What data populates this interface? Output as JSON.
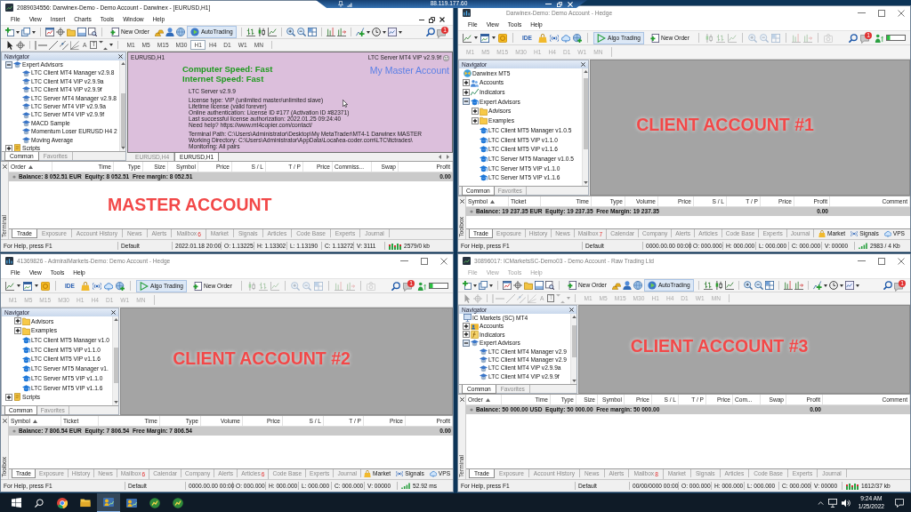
{
  "remote_bar": {
    "address": "88.119.177.60"
  },
  "windows": [
    {
      "kind": "mt4",
      "active": true,
      "caption_buttons": false,
      "title": "2089034556: Darwinex-Demo - Demo Account - Darwinex - [EURUSD,H1]",
      "menu": {
        "disabled": false,
        "items": [
          "File",
          "View",
          "Insert",
          "Charts",
          "Tools",
          "Window",
          "Help"
        ]
      },
      "toolbar": {
        "buttons": [
          {
            "label": "New Order",
            "on": false
          },
          {
            "label": "AutoTrading",
            "on": true
          }
        ],
        "alerts": "1"
      },
      "chart_tools": {
        "disabled": false,
        "labels": [
          "A",
          "T"
        ],
        "timeframes": [
          {
            "label": "M1",
            "selected": false
          },
          {
            "label": "M5",
            "selected": false
          },
          {
            "label": "M15",
            "selected": false
          },
          {
            "label": "M30",
            "selected": false
          },
          {
            "label": "H1",
            "selected": true
          },
          {
            "label": "H4",
            "selected": false
          },
          {
            "label": "D1",
            "selected": false
          },
          {
            "label": "W1",
            "selected": false
          },
          {
            "label": "MN",
            "selected": false
          }
        ]
      },
      "navigator": {
        "title": "Navigator",
        "items": [
          {
            "kind": "group",
            "label": "Expert Advisors",
            "expanded": true,
            "children": [
              {
                "kind": "expert",
                "label": "LTC Client MT4 Manager v2.9.8"
              },
              {
                "kind": "expert",
                "label": "LTC Client MT4 VIP v2.9.9a"
              },
              {
                "kind": "expert",
                "label": "LTC Client MT4 VIP v2.9.9f"
              },
              {
                "kind": "expert",
                "label": "LTC Server MT4 Manager v2.9.8"
              },
              {
                "kind": "expert",
                "label": "LTC Server MT4 VIP v2.9.9a"
              },
              {
                "kind": "expert",
                "label": "LTC Server MT4 VIP v2.9.9f"
              },
              {
                "kind": "expert",
                "label": "MACD Sample"
              },
              {
                "kind": "expert",
                "label": "Momentum Loser EURUSD H4 2"
              },
              {
                "kind": "expert",
                "label": "Moving Average"
              }
            ]
          },
          {
            "kind": "scripts",
            "label": "Scripts",
            "expanded": false
          }
        ],
        "tabs": [
          {
            "label": "Common",
            "selected": true
          },
          {
            "label": "Favorites",
            "selected": false
          }
        ]
      },
      "chart": {
        "symbol": "EURUSD,H1",
        "expert": "LTC Server MT4 VIP v2.9.9f",
        "speed": [
          "Computer Speed: Fast",
          "Internet Speed: Fast"
        ],
        "account": "My Master Account",
        "blocks": [
          [
            "LTC Server v2.9.9"
          ],
          [
            "License type: VIP (unlimited master/unlimited slave)",
            "Lifetime license (valid forever)",
            "Online authentication: License ID #177 (Activation ID #82371)",
            "Last successful license authorization: 2022.01.25 09:24:40",
            "Need help? https://www.mt4copier.com/contact/"
          ],
          [
            "Terminal Path: C:\\Users\\Administrator\\Desktop\\My MetaTrader\\MT4-1 Darwinex MASTER",
            "Working Directory: C:\\Users\\Administrator\\AppData\\Local\\ea-coder.com\\LTC\\ltctrades\\",
            "Monitoring: All pairs"
          ]
        ]
      },
      "chart_tabs": [
        {
          "label": "EURUSD,H4",
          "selected": false
        },
        {
          "label": "EURUSD,H1",
          "selected": true
        }
      ],
      "terminal": {
        "label": "Terminal",
        "banner": "MASTER ACCOUNT",
        "columns": [
          {
            "label": "Order",
            "kind": "text",
            "sorted": true
          },
          {
            "label": "Time",
            "kind": "number",
            "sorted": false
          },
          {
            "label": "Type",
            "kind": "number",
            "sorted": false
          },
          {
            "label": "Size",
            "kind": "number",
            "sorted": false
          },
          {
            "label": "Symbol",
            "kind": "number",
            "sorted": false
          },
          {
            "label": "Price",
            "kind": "number",
            "sorted": false
          },
          {
            "label": "S / L",
            "kind": "number",
            "sorted": false
          },
          {
            "label": "T / P",
            "kind": "number",
            "sorted": false
          },
          {
            "label": "Price",
            "kind": "number",
            "sorted": false
          },
          {
            "label": "Commiss...",
            "kind": "text",
            "sorted": false
          },
          {
            "label": "Swap",
            "kind": "number",
            "sorted": false
          },
          {
            "label": "Profit",
            "kind": "profit",
            "sorted": false
          }
        ],
        "balance": {
          "text": "Balance: 8 052.51 EUR  Equity: 8 052.51  Free margin: 8 052.51",
          "profit": "0.00"
        },
        "tabs": [
          {
            "label": "Trade",
            "selected": true
          },
          {
            "label": "Exposure",
            "selected": false
          },
          {
            "label": "Account History",
            "selected": false
          },
          {
            "label": "News",
            "selected": false
          },
          {
            "label": "Alerts",
            "selected": false
          },
          {
            "label": "Mailbox",
            "badge": "6",
            "selected": false
          },
          {
            "label": "Market",
            "selected": false
          },
          {
            "label": "Signals",
            "selected": false
          },
          {
            "label": "Articles",
            "selected": false
          },
          {
            "label": "Code Base",
            "selected": false
          },
          {
            "label": "Experts",
            "selected": false
          },
          {
            "label": "Journal",
            "selected": false
          }
        ]
      },
      "status_bar": {
        "segments": [
          "For Help, press F1",
          "Default",
          "2022.01.18 20:00",
          "O: 1.13225",
          "H: 1.13302",
          "L: 1.13190",
          "C: 1.13272",
          "V: 3111"
        ],
        "traffic": "2579/0 kb"
      }
    },
    {
      "kind": "mt5",
      "active": false,
      "caption_buttons": true,
      "title": "Darwinex-Demo: Demo Account - Hedge",
      "menu": {
        "disabled": false,
        "items": [
          "File",
          "View",
          "Tools",
          "Help"
        ]
      },
      "toolbar": {
        "buttons": [
          {
            "label": "IDE",
            "on": false
          },
          {
            "label": "Algo Trading",
            "on": true
          },
          {
            "label": "New Order",
            "on": false
          }
        ],
        "alerts": "1"
      },
      "chart_tools": {
        "disabled": true,
        "timeframes": [
          {
            "label": "M1",
            "selected": false
          },
          {
            "label": "M5",
            "selected": false
          },
          {
            "label": "M15",
            "selected": false
          },
          {
            "label": "M30",
            "selected": false
          },
          {
            "label": "H1",
            "selected": false
          },
          {
            "label": "H4",
            "selected": false
          },
          {
            "label": "D1",
            "selected": false
          },
          {
            "label": "W1",
            "selected": false
          },
          {
            "label": "MN",
            "selected": false
          }
        ]
      },
      "navigator": {
        "title": "Navigator",
        "items": [
          {
            "kind": "root",
            "label": "Darwinex MT5",
            "children": [
              {
                "kind": "accounts",
                "label": "Accounts",
                "expanded": false
              },
              {
                "kind": "indicators",
                "label": "Indicators",
                "expanded": false
              },
              {
                "kind": "group",
                "label": "Expert Advisors",
                "expanded": true,
                "children": [
                  {
                    "kind": "folder",
                    "label": "Advisors",
                    "expanded": false
                  },
                  {
                    "kind": "folder",
                    "label": "Examples",
                    "expanded": false
                  },
                  {
                    "kind": "expert",
                    "label": "LTC Client MT5 Manager v1.0.5"
                  },
                  {
                    "kind": "expert",
                    "label": "LTC Client MT5 VIP v1.1.0"
                  },
                  {
                    "kind": "expert",
                    "label": "LTC Client MT5 VIP v1.1.6"
                  },
                  {
                    "kind": "expert",
                    "label": "LTC Server MT5 Manager v1.0.5"
                  },
                  {
                    "kind": "expert",
                    "label": "LTC Server MT5 VIP v1.1.0"
                  },
                  {
                    "kind": "expert",
                    "label": "LTC Server MT5 VIP v1.1.6"
                  }
                ]
              }
            ]
          }
        ],
        "tabs": [
          {
            "label": "Common",
            "selected": true
          },
          {
            "label": "Favorites",
            "selected": false
          }
        ]
      },
      "workspace": {
        "banner": "CLIENT ACCOUNT #1"
      },
      "terminal": {
        "label": "Toolbox",
        "columns": [
          {
            "label": "Symbol",
            "kind": "text",
            "sorted": true
          },
          {
            "label": "Ticket",
            "kind": "text",
            "sorted": false
          },
          {
            "label": "Time",
            "kind": "number",
            "sorted": false
          },
          {
            "label": "Type",
            "kind": "number",
            "sorted": false
          },
          {
            "label": "Volume",
            "kind": "number",
            "sorted": false
          },
          {
            "label": "Price",
            "kind": "number",
            "sorted": false
          },
          {
            "label": "S / L",
            "kind": "number",
            "sorted": false
          },
          {
            "label": "T / P",
            "kind": "number",
            "sorted": false
          },
          {
            "label": "Price",
            "kind": "number",
            "sorted": false
          },
          {
            "label": "Profit",
            "kind": "profit",
            "sorted": false
          },
          {
            "label": "Comment",
            "kind": "number",
            "sorted": false
          }
        ],
        "balance": {
          "text": "Balance: 19 237.35 EUR  Equity: 19 237.35  Free Margin: 19 237.35",
          "profit": "0.00"
        },
        "tabs": [
          {
            "label": "Trade",
            "selected": true
          },
          {
            "label": "Exposure",
            "selected": false
          },
          {
            "label": "History",
            "selected": false
          },
          {
            "label": "News",
            "selected": false
          },
          {
            "label": "Mailbox",
            "badge": "7",
            "selected": false
          },
          {
            "label": "Calendar",
            "selected": false
          },
          {
            "label": "Company",
            "selected": false
          },
          {
            "label": "Alerts",
            "selected": false
          },
          {
            "label": "Articles",
            "selected": false
          },
          {
            "label": "Code Base",
            "selected": false
          },
          {
            "label": "Experts",
            "selected": false
          },
          {
            "label": "Journal",
            "selected": false
          }
        ],
        "services": [
          {
            "label": "Market"
          },
          {
            "label": "Signals"
          },
          {
            "label": "VPS"
          }
        ]
      },
      "status_bar": {
        "segments": [
          "For Help, press F1",
          "Default",
          "0000.00.00 00:00",
          "O: 000.000",
          "H: 000.000",
          "L: 000.000",
          "C: 000.000",
          "V: 00000"
        ],
        "traffic": "2983 / 4 Kb"
      }
    },
    {
      "kind": "mt5",
      "active": false,
      "caption_buttons": true,
      "title": "41369826 - AdmiralMarkets-Demo: Demo Account - Hedge",
      "menu": {
        "disabled": false,
        "items": [
          "File",
          "View",
          "Tools",
          "Help"
        ]
      },
      "toolbar": {
        "buttons": [
          {
            "label": "IDE",
            "on": false
          },
          {
            "label": "Algo Trading",
            "on": true
          },
          {
            "label": "New Order",
            "on": false
          }
        ],
        "alerts": "1"
      },
      "chart_tools": {
        "disabled": true,
        "timeframes": [
          {
            "label": "M1",
            "selected": false
          },
          {
            "label": "M5",
            "selected": false
          },
          {
            "label": "M15",
            "selected": false
          },
          {
            "label": "M30",
            "selected": false
          },
          {
            "label": "H1",
            "selected": false
          },
          {
            "label": "H4",
            "selected": false
          },
          {
            "label": "D1",
            "selected": false
          },
          {
            "label": "W1",
            "selected": false
          },
          {
            "label": "MN",
            "selected": false
          }
        ]
      },
      "navigator": {
        "title": "Navigator",
        "items": [
          {
            "kind": "continued",
            "children": [
              {
                "kind": "folder",
                "label": "Advisors",
                "expanded": false
              },
              {
                "kind": "folder",
                "label": "Examples",
                "expanded": false
              },
              {
                "kind": "expert",
                "label": "LTC Client MT5 Manager v1.0"
              },
              {
                "kind": "expert",
                "label": "LTC Client MT5 VIP v1.1.0"
              },
              {
                "kind": "expert",
                "label": "LTC Client MT5 VIP v1.1.6"
              },
              {
                "kind": "expert",
                "label": "LTC Server MT5 Manager v1."
              },
              {
                "kind": "expert",
                "label": "LTC Server MT5 VIP v1.1.0"
              },
              {
                "kind": "expert",
                "label": "LTC Server MT5 VIP v1.1.6"
              }
            ]
          },
          {
            "kind": "scripts",
            "label": "Scripts",
            "expanded": false
          }
        ],
        "tabs": [
          {
            "label": "Common",
            "selected": true
          },
          {
            "label": "Favorites",
            "selected": false
          }
        ]
      },
      "workspace": {
        "banner": "CLIENT ACCOUNT #2"
      },
      "terminal": {
        "label": "Toolbox",
        "columns": [
          {
            "label": "Symbol",
            "kind": "text",
            "sorted": true
          },
          {
            "label": "Ticket",
            "kind": "text",
            "sorted": false
          },
          {
            "label": "Time",
            "kind": "number",
            "sorted": false
          },
          {
            "label": "Type",
            "kind": "number",
            "sorted": false
          },
          {
            "label": "Volume",
            "kind": "number",
            "sorted": false
          },
          {
            "label": "Price",
            "kind": "number",
            "sorted": false
          },
          {
            "label": "S / L",
            "kind": "number",
            "sorted": false
          },
          {
            "label": "T / P",
            "kind": "number",
            "sorted": false
          },
          {
            "label": "Price",
            "kind": "number",
            "sorted": false
          },
          {
            "label": "Profit",
            "kind": "profit",
            "sorted": false
          }
        ],
        "balance": {
          "text": "Balance: 7 806.54 EUR  Equity: 7 806.54  Free Margin: 7 806.54",
          "profit": "0.00"
        },
        "tabs": [
          {
            "label": "Trade",
            "selected": true
          },
          {
            "label": "Exposure",
            "selected": false
          },
          {
            "label": "History",
            "selected": false
          },
          {
            "label": "News",
            "selected": false
          },
          {
            "label": "Mailbox",
            "badge": "6",
            "selected": false
          },
          {
            "label": "Calendar",
            "selected": false
          },
          {
            "label": "Company",
            "selected": false
          },
          {
            "label": "Alerts",
            "selected": false
          },
          {
            "label": "Articles",
            "badge": "6",
            "selected": false
          },
          {
            "label": "Code Base",
            "selected": false
          },
          {
            "label": "Experts",
            "selected": false
          },
          {
            "label": "Journal",
            "selected": false
          }
        ],
        "services": [
          {
            "label": "Market"
          },
          {
            "label": "Signals"
          },
          {
            "label": "VPS"
          }
        ]
      },
      "status_bar": {
        "segments": [
          "For Help, press F1",
          "Default",
          "0000.00.00 00:00",
          "O: 000.000",
          "H: 000.000",
          "L: 000.000",
          "C: 000.000",
          "V: 00000"
        ],
        "traffic": "52.92 ms"
      }
    },
    {
      "kind": "mt4",
      "active": false,
      "caption_buttons": true,
      "title": "30896017: ICMarketsSC-Demo03 - Demo Account - Raw Trading Ltd",
      "menu": {
        "disabled": true,
        "items": [
          "File",
          "View",
          "Tools",
          "Help"
        ]
      },
      "toolbar": {
        "buttons": [
          {
            "label": "New Order",
            "on": false
          },
          {
            "label": "AutoTrading",
            "on": true
          }
        ],
        "alerts": "1"
      },
      "chart_tools": {
        "disabled": true,
        "labels": [
          "A",
          "T"
        ],
        "timeframes": [
          {
            "label": "M1",
            "selected": false
          },
          {
            "label": "M5",
            "selected": false
          },
          {
            "label": "M15",
            "selected": false
          },
          {
            "label": "M30",
            "selected": false
          },
          {
            "label": "H1",
            "selected": false
          },
          {
            "label": "H4",
            "selected": false
          },
          {
            "label": "D1",
            "selected": false
          },
          {
            "label": "W1",
            "selected": false
          },
          {
            "label": "MN",
            "selected": false
          }
        ]
      },
      "navigator": {
        "title": "Navigator",
        "items": [
          {
            "kind": "root",
            "label": "IC Markets (SC) MT4",
            "children": [
              {
                "kind": "accounts",
                "label": "Accounts",
                "expanded": false
              },
              {
                "kind": "indicators",
                "label": "Indicators",
                "expanded": false
              },
              {
                "kind": "group",
                "label": "Expert Advisors",
                "expanded": true,
                "children": [
                  {
                    "kind": "expert",
                    "label": "LTC Client MT4 Manager v2.9"
                  },
                  {
                    "kind": "expert",
                    "label": "LTC Client MT4 Manager v2.9"
                  },
                  {
                    "kind": "expert",
                    "label": "LTC Client MT4 VIP v2.9.9a"
                  },
                  {
                    "kind": "expert",
                    "label": "LTC Client MT4 VIP v2.9.9f"
                  }
                ]
              }
            ]
          }
        ],
        "tabs": [
          {
            "label": "Common",
            "selected": true
          },
          {
            "label": "Favorites",
            "selected": false
          }
        ]
      },
      "workspace": {
        "banner": "CLIENT ACCOUNT #3"
      },
      "terminal": {
        "label": "Terminal",
        "columns": [
          {
            "label": "Order",
            "kind": "text",
            "sorted": true
          },
          {
            "label": "Time",
            "kind": "number",
            "sorted": false
          },
          {
            "label": "Type",
            "kind": "number",
            "sorted": false
          },
          {
            "label": "Size",
            "kind": "number",
            "sorted": false
          },
          {
            "label": "Symbol",
            "kind": "number",
            "sorted": false
          },
          {
            "label": "Price",
            "kind": "number",
            "sorted": false
          },
          {
            "label": "S / L",
            "kind": "number",
            "sorted": false
          },
          {
            "label": "T / P",
            "kind": "number",
            "sorted": false
          },
          {
            "label": "Price",
            "kind": "number",
            "sorted": false
          },
          {
            "label": "Com...",
            "kind": "text",
            "sorted": false
          },
          {
            "label": "Swap",
            "kind": "number",
            "sorted": false
          },
          {
            "label": "Profit",
            "kind": "profit",
            "sorted": false
          },
          {
            "label": "Comment",
            "kind": "number",
            "sorted": false
          }
        ],
        "balance": {
          "text": "Balance: 50 000.00 USD  Equity: 50 000.00  Free margin: 50 000.00",
          "profit": "0.00"
        },
        "tabs": [
          {
            "label": "Trade",
            "selected": true
          },
          {
            "label": "Exposure",
            "selected": false
          },
          {
            "label": "Account History",
            "selected": false
          },
          {
            "label": "News",
            "selected": false
          },
          {
            "label": "Alerts",
            "selected": false
          },
          {
            "label": "Mailbox",
            "badge": "8",
            "selected": false
          },
          {
            "label": "Market",
            "selected": false
          },
          {
            "label": "Signals",
            "selected": false
          },
          {
            "label": "Articles",
            "selected": false
          },
          {
            "label": "Code Base",
            "selected": false
          },
          {
            "label": "Experts",
            "selected": false
          },
          {
            "label": "Journal",
            "selected": false
          }
        ]
      },
      "status_bar": {
        "segments": [
          "For Help, press F1",
          "Default",
          "00/00/0000 00:00",
          "O: 000.000",
          "H: 000.000",
          "L: 000.000",
          "C: 000.000",
          "V: 00000"
        ],
        "traffic": "1612/37 kb"
      }
    }
  ],
  "taskbar": {
    "apps": [
      {
        "selected": true
      },
      {
        "selected": false
      },
      {
        "selected": false
      },
      {
        "selected": false
      }
    ],
    "time": "9:24 AM",
    "date": "1/25/2022"
  }
}
